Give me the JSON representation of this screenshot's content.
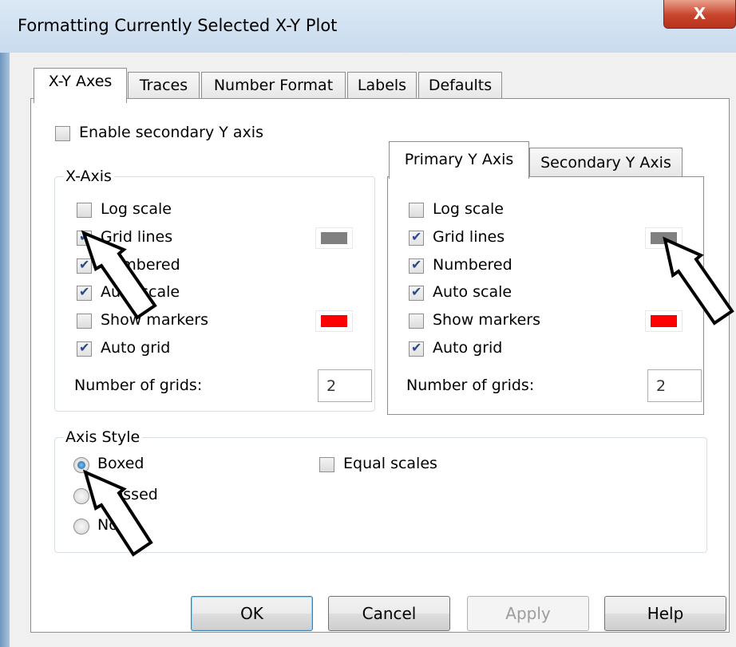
{
  "window": {
    "title": "Formatting Currently Selected X-Y Plot",
    "close_label": "X"
  },
  "tabs": [
    "X-Y Axes",
    "Traces",
    "Number Format",
    "Labels",
    "Defaults"
  ],
  "enable_secondary": {
    "label": "Enable secondary Y axis",
    "checked": false
  },
  "x_axis": {
    "legend": "X-Axis",
    "options": [
      {
        "label": "Log scale",
        "checked": false
      },
      {
        "label": "Grid lines",
        "checked": true
      },
      {
        "label": "Numbered",
        "checked": true
      },
      {
        "label": "Auto scale",
        "checked": true
      },
      {
        "label": "Show markers",
        "checked": false
      },
      {
        "label": "Auto grid",
        "checked": true
      }
    ],
    "grid_color": "#808080",
    "marker_color": "#ff0000",
    "grids_label": "Number of grids:",
    "grids_value": "2"
  },
  "y_tabs": [
    "Primary Y Axis",
    "Secondary Y Axis"
  ],
  "y_axis": {
    "options": [
      {
        "label": "Log scale",
        "checked": false
      },
      {
        "label": "Grid lines",
        "checked": true
      },
      {
        "label": "Numbered",
        "checked": true
      },
      {
        "label": "Auto scale",
        "checked": true
      },
      {
        "label": "Show markers",
        "checked": false
      },
      {
        "label": "Auto grid",
        "checked": true
      }
    ],
    "grid_color": "#808080",
    "marker_color": "#ff0000",
    "grids_label": "Number of grids:",
    "grids_value": "2"
  },
  "axis_style": {
    "legend": "Axis Style",
    "options": [
      "Boxed",
      "Crossed",
      "None"
    ],
    "selected": "Boxed",
    "equal_scales": {
      "label": "Equal scales",
      "checked": false
    }
  },
  "buttons": {
    "ok": "OK",
    "cancel": "Cancel",
    "apply": "Apply",
    "help": "Help"
  },
  "annotation_arrow_color": "#000000"
}
